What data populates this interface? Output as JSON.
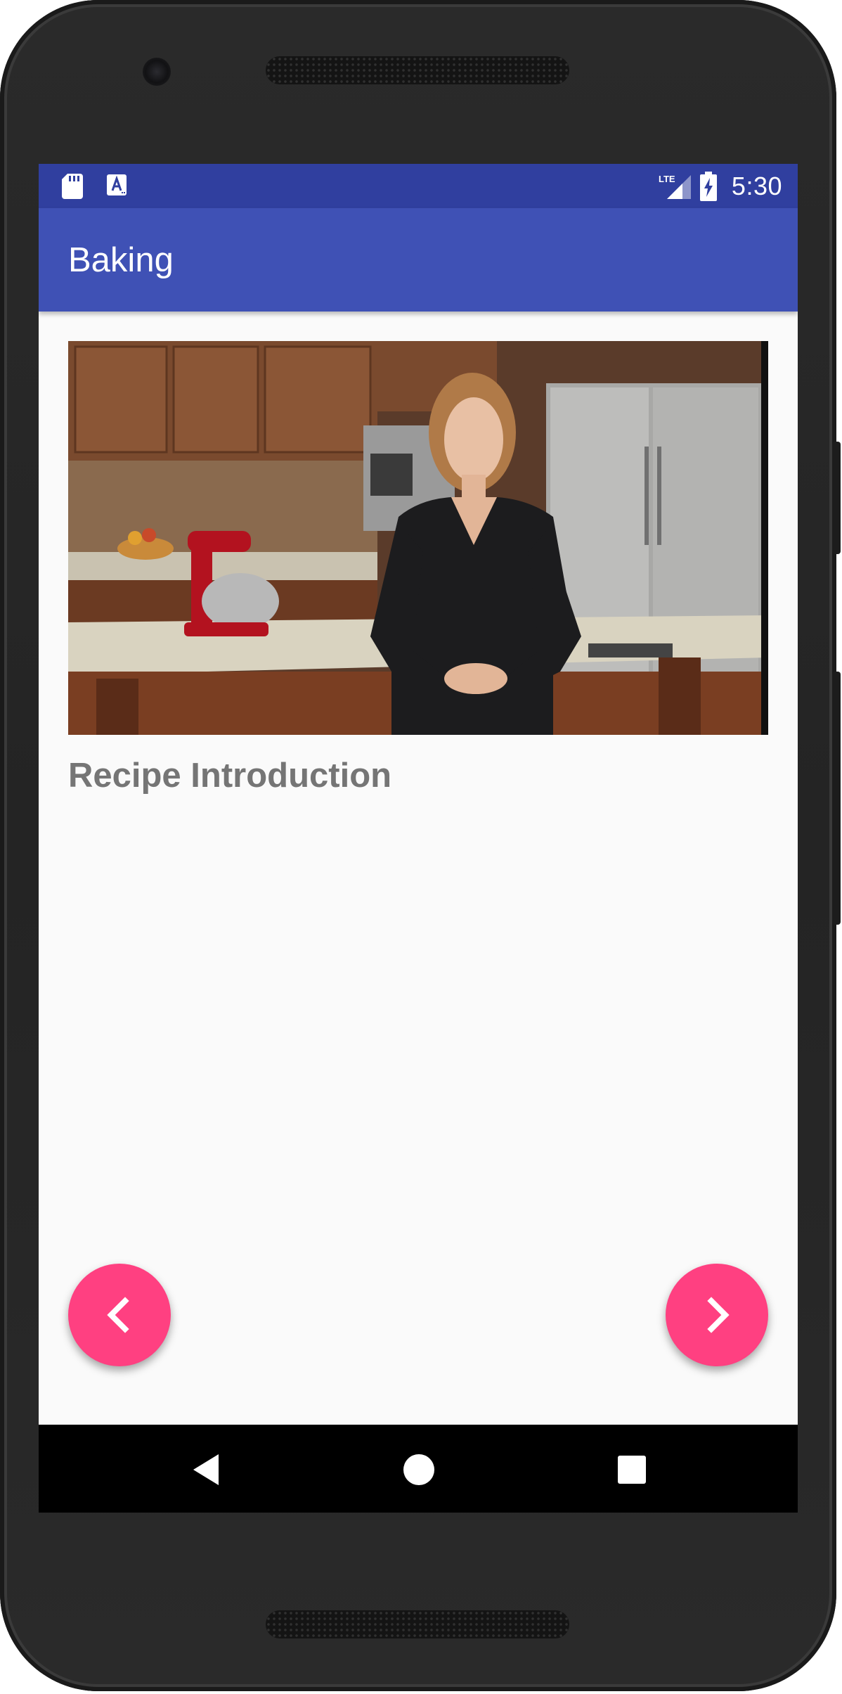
{
  "status_bar": {
    "time": "5:30",
    "network_label": "LTE",
    "left_icons": [
      "sd-card-icon",
      "text-a-icon"
    ],
    "right_icons": [
      "lte-signal-icon",
      "battery-charging-icon"
    ]
  },
  "app_bar": {
    "title": "Baking"
  },
  "step": {
    "title": "Recipe Introduction"
  },
  "buttons": {
    "prev_icon": "chevron-left-icon",
    "next_icon": "chevron-right-icon"
  },
  "nav_bar": {
    "back_icon": "back-triangle-icon",
    "home_icon": "home-circle-icon",
    "recents_icon": "recents-square-icon"
  },
  "colors": {
    "status_bar": "#303f9f",
    "app_bar": "#3f51b5",
    "fab": "#ff4081",
    "step_title": "#757575",
    "screen_bg": "#fafafa"
  }
}
